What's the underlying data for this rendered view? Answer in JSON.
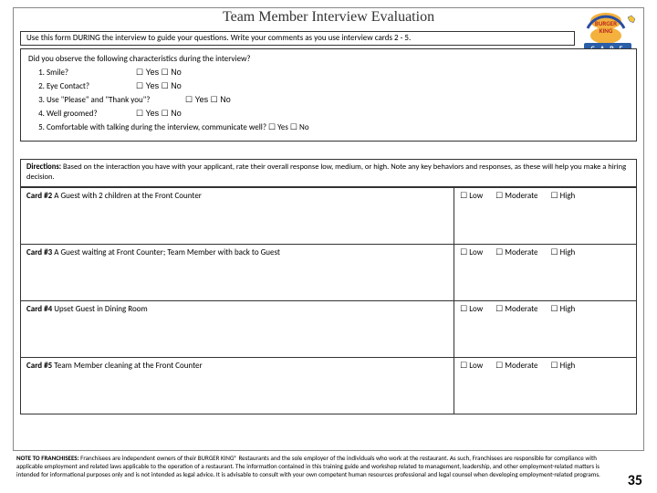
{
  "title": "Team Member Interview Evaluation",
  "intro": "Use this form DURING the interview to guide your questions. Write your comments as you use interview cards 2 - 5.",
  "observe": {
    "prompt": "Did you observe the following characteristics during the interview?",
    "items": [
      {
        "label": "Smile?",
        "opts": "☐ Yes  ☐ No"
      },
      {
        "label": "Eye Contact?",
        "opts": "☐ Yes  ☐ No"
      },
      {
        "label": "Use \"Please\" and \"Thank you\"?",
        "opts": "☐ Yes  ☐ No"
      },
      {
        "label": "Well groomed?",
        "opts": "☐ Yes  ☐ No"
      },
      {
        "label": "Comfortable with talking during the interview, communicate well?     ☐ Yes  ☐ No",
        "opts": ""
      }
    ]
  },
  "directions_label": "Directions:",
  "directions": " Based on the interaction you have with your applicant, rate their overall response low, medium, or high. Note any key behaviors and responses, as these will help you make a hiring decision.",
  "rating_opts": {
    "low": "☐ Low",
    "mod": "☐ Moderate",
    "high": "☐ High"
  },
  "cards": [
    {
      "id": "Card #2",
      "scenario": "A Guest with 2 children at the Front Counter"
    },
    {
      "id": "Card #3",
      "scenario": "A Guest waiting at Front Counter; Team Member with back to Guest"
    },
    {
      "id": "Card #4",
      "scenario": "Upset Guest in Dining Room"
    },
    {
      "id": "Card #5",
      "scenario": "Team Member cleaning at the Front Counter"
    }
  ],
  "footnote_label": "NOTE TO FRANCHISEES:",
  "footnote": " Franchisees are independent owners of their BURGER KING® Restaurants and the sole employer of the individuals who work at the restaurant. As such, Franchisees are responsible for compliance with applicable employment and related laws applicable to the operation of a restaurant. The information contained in this training guide and workshop related to management, leadership, and other employment-related matters is intended for informational purposes only and is not intended as legal advice. It is advisable to consult with your own competent human resources professional and legal counsel when developing employment-related programs.",
  "page": "35",
  "logo_text": {
    "top": "BURGER",
    "mid": "KING",
    "care": "C A R E"
  }
}
